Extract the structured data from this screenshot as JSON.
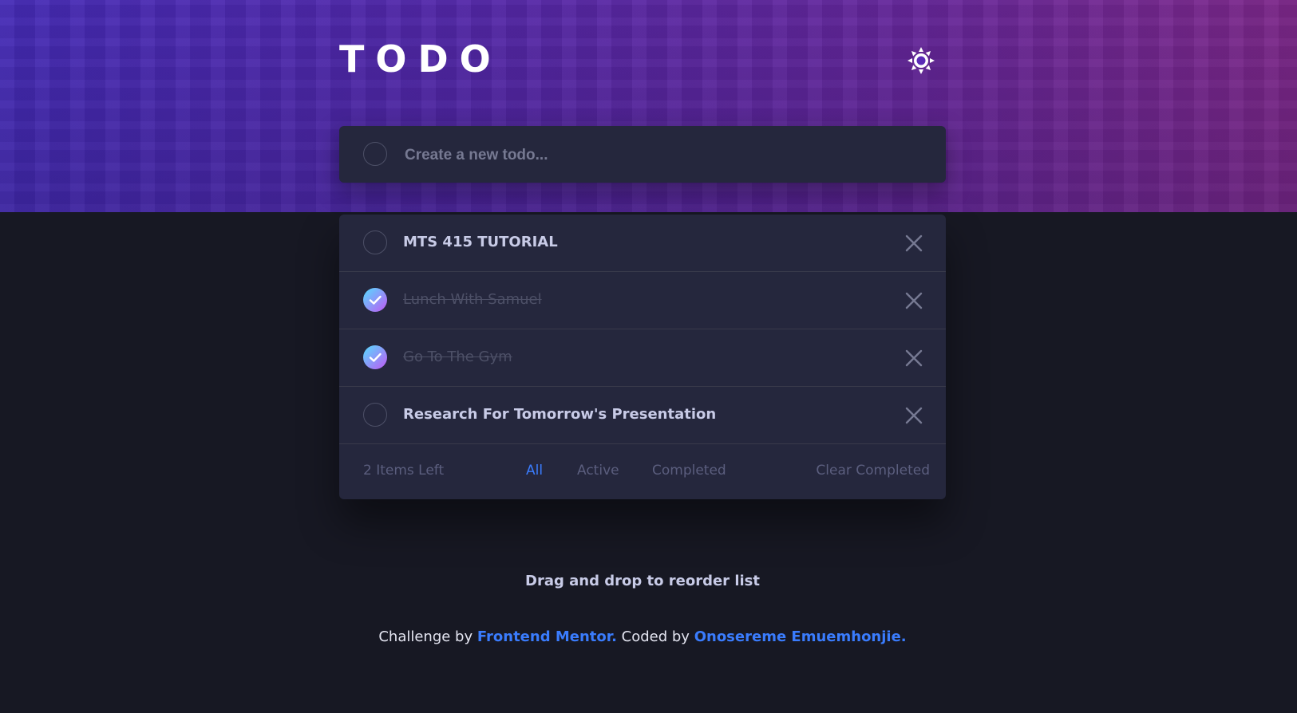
{
  "header": {
    "title": "TODO",
    "theme_icon": "sun-icon"
  },
  "new_todo": {
    "placeholder": "Create a new todo...",
    "value": ""
  },
  "todos": [
    {
      "text": "MTS 415 TUTORIAL",
      "completed": false
    },
    {
      "text": "Lunch With Samuel",
      "completed": true
    },
    {
      "text": "Go To The Gym",
      "completed": true
    },
    {
      "text": "Research For Tomorrow's Presentation",
      "completed": false
    }
  ],
  "footer": {
    "items_left": "2 Items Left",
    "filters": [
      "All",
      "Active",
      "Completed"
    ],
    "active_filter": "All",
    "clear_label": "Clear Completed"
  },
  "hint": "Drag and drop to reorder list",
  "attribution": {
    "prefix": "Challenge by",
    "challenge_link": "Frontend Mentor.",
    "middle": "Coded by",
    "author_link": "Onosereme Emuemhonjie."
  },
  "colors": {
    "background": "#171823",
    "card": "#25273d",
    "accent": "#3a7cfd",
    "check_gradient_start": "#55ddff",
    "check_gradient_end": "#c058f3"
  }
}
